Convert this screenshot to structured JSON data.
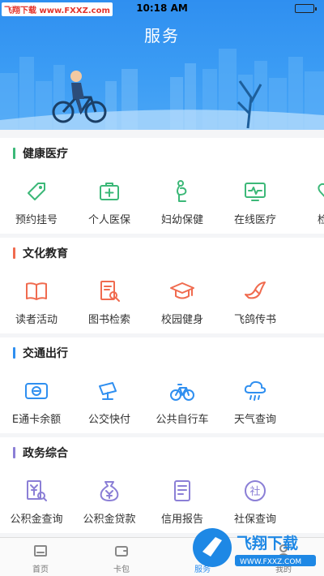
{
  "status_bar": {
    "watermark": "飞翔下载 www.FXXZ.com",
    "time": "10:18 AM"
  },
  "page_title": "服务",
  "sections": [
    {
      "title": "健康医疗",
      "color": "#3cb878",
      "items": [
        {
          "label": "预约挂号",
          "icon": "tag-icon"
        },
        {
          "label": "个人医保",
          "icon": "medical-kit-icon"
        },
        {
          "label": "妇幼保健",
          "icon": "pregnant-icon"
        },
        {
          "label": "在线医疗",
          "icon": "monitor-pulse-icon"
        },
        {
          "label": "检查",
          "icon": "heart-icon"
        }
      ]
    },
    {
      "title": "文化教育",
      "color": "#f06b4f",
      "items": [
        {
          "label": "读者活动",
          "icon": "book-icon"
        },
        {
          "label": "图书检索",
          "icon": "book-search-icon"
        },
        {
          "label": "校园健身",
          "icon": "graduation-cap-icon"
        },
        {
          "label": "飞鸽传书",
          "icon": "pigeon-icon"
        }
      ]
    },
    {
      "title": "交通出行",
      "color": "#2f8ff0",
      "items": [
        {
          "label": "E通卡余额",
          "icon": "e-card-icon"
        },
        {
          "label": "公交快付",
          "icon": "camera-icon"
        },
        {
          "label": "公共自行车",
          "icon": "bicycle-icon"
        },
        {
          "label": "天气查询",
          "icon": "cloud-rain-icon"
        }
      ]
    },
    {
      "title": "政务综合",
      "color": "#8b7fd6",
      "items": [
        {
          "label": "公积金查询",
          "icon": "yuan-search-icon"
        },
        {
          "label": "公积金贷款",
          "icon": "money-bag-icon"
        },
        {
          "label": "信用报告",
          "icon": "report-icon"
        },
        {
          "label": "社保查询",
          "icon": "social-security-icon"
        }
      ]
    }
  ],
  "tabs": [
    {
      "label": "首页",
      "icon": "home-icon",
      "active": false
    },
    {
      "label": "卡包",
      "icon": "wallet-icon",
      "active": false
    },
    {
      "label": "服务",
      "icon": "service-icon",
      "active": true
    },
    {
      "label": "我的",
      "icon": "user-icon",
      "active": false
    }
  ],
  "watermark_logo": {
    "brand": "飞翔下载",
    "url": "WWW.FXXZ.COM"
  }
}
